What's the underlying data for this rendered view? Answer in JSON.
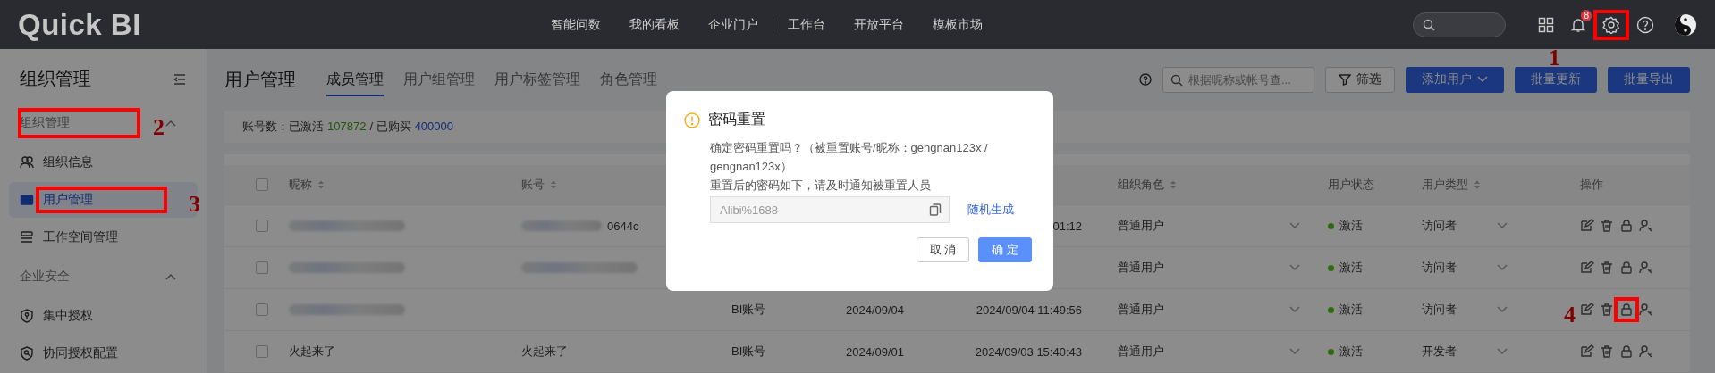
{
  "top_bar": {
    "logo": "Quick BI",
    "nav": [
      {
        "label": "智能问数",
        "divider_before": false
      },
      {
        "label": "我的看板",
        "divider_before": false
      },
      {
        "label": "企业门户",
        "divider_before": false
      },
      {
        "label": "工作台",
        "divider_before": true
      },
      {
        "label": "开放平台",
        "divider_before": false
      },
      {
        "label": "模板市场",
        "divider_before": false
      }
    ],
    "notification_count": "8"
  },
  "sidebar": {
    "title": "组织管理",
    "sections": [
      {
        "label": "组织管理",
        "expanded": true,
        "items": [
          {
            "label": "组织信息",
            "selected": false
          },
          {
            "label": "用户管理",
            "selected": true
          },
          {
            "label": "工作空间管理",
            "selected": false
          }
        ]
      },
      {
        "label": "企业安全",
        "expanded": true,
        "items": [
          {
            "label": "集中授权",
            "selected": false
          },
          {
            "label": "协同授权配置",
            "selected": false
          }
        ]
      }
    ]
  },
  "page": {
    "title": "用户管理",
    "tabs": [
      {
        "label": "成员管理",
        "selected": true
      },
      {
        "label": "用户组管理",
        "selected": false
      },
      {
        "label": "用户标签管理",
        "selected": false
      },
      {
        "label": "角色管理",
        "selected": false
      }
    ],
    "search": {
      "placeholder": "根据昵称或帐号查..."
    },
    "filter_button": "筛选",
    "buttons": [
      {
        "label": "添加用户",
        "dropdown": true
      },
      {
        "label": "批量更新",
        "dropdown": false
      },
      {
        "label": "批量导出",
        "dropdown": false
      }
    ],
    "stats": {
      "label": "账号数：已激活",
      "active": "107872",
      "separator": "/ 已购买",
      "purchased": "400000"
    }
  },
  "table": {
    "header_checked": false,
    "columns": [
      {
        "label": "昵称",
        "sortable": true
      },
      {
        "label": "账号",
        "sortable": true
      },
      {
        "label": "组织角色",
        "sortable": true
      },
      {
        "label": "用户状态",
        "sortable": false
      },
      {
        "label": "用户类型",
        "sortable": true
      },
      {
        "label": "操作",
        "sortable": false
      }
    ],
    "rows": [
      {
        "checked": false,
        "nickname": {
          "blurred": true
        },
        "account": {
          "blurred": true,
          "text": "0644c"
        },
        "last_login": "01:12",
        "role": "普通用户",
        "status": {
          "label": "激活",
          "color": "#2d6c0e"
        },
        "type": "访问者"
      },
      {
        "checked": false,
        "nickname": {
          "blurred": true
        },
        "account": {
          "blurred": true
        },
        "role": "普通用户",
        "status": {
          "label": "激活",
          "color": "#2d6c0e"
        },
        "type": "访问者"
      },
      {
        "checked": false,
        "nickname": {
          "blurred": true
        },
        "source": "BI账号",
        "created": "2024/09/04",
        "last_login": "2024/09/04 11:49:56",
        "role": "普通用户",
        "status": {
          "label": "激活",
          "color": "#2d6c0e"
        },
        "type": "访问者"
      },
      {
        "checked": false,
        "nickname": {
          "blurred": false,
          "text": "火起来了"
        },
        "account": {
          "blurred": false,
          "text": "火起来了"
        },
        "source": "BI账号",
        "created": "2024/09/01",
        "last_login": "2024/09/03 15:40:43",
        "role": "普通用户",
        "status": {
          "label": "激活",
          "color": "#2d6c0e"
        },
        "type": "开发者"
      }
    ]
  },
  "dialog": {
    "title": "密码重置",
    "message": "确定密码重置吗？（被重置账号/昵称：gengnan123x / gengnan123x）",
    "note": "重置后的密码如下，请及时通知被重置人员",
    "password": "Alibi%1688",
    "generate_link": "随机生成",
    "cancel": "取 消",
    "confirm": "确 定"
  },
  "annotations": [
    {
      "label": "1",
      "kind": "settings"
    },
    {
      "label": "2",
      "kind": "section"
    },
    {
      "label": "3",
      "kind": "nav"
    },
    {
      "label": "4",
      "kind": "action"
    }
  ]
}
